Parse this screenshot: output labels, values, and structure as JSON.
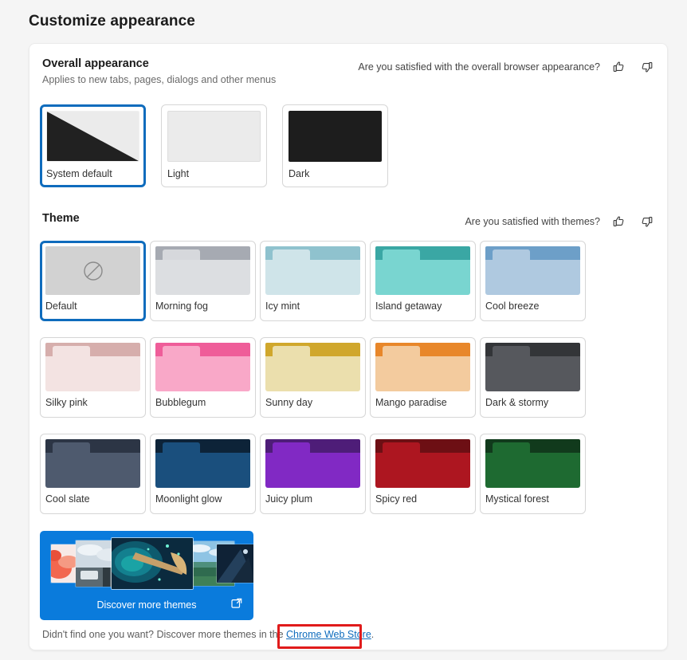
{
  "page": {
    "title": "Customize appearance",
    "background": "#f5f5f5",
    "accent": "#0f6cbd",
    "annotation_color": "#e01b1b"
  },
  "overall_appearance": {
    "title": "Overall appearance",
    "subtitle": "Applies to new tabs, pages, dialogs and other menus",
    "feedback": {
      "question": "Are you satisfied with the overall browser appearance?",
      "thumbs_up": "thumbs-up-icon",
      "thumbs_down": "thumbs-down-icon"
    },
    "options": [
      {
        "label": "System default",
        "selected": true,
        "kind": "split",
        "light": "#ebebeb",
        "dark": "#212121"
      },
      {
        "label": "Light",
        "selected": false,
        "kind": "solid",
        "fill": "#ebebeb"
      },
      {
        "label": "Dark",
        "selected": false,
        "kind": "solid",
        "fill": "#1d1d1d"
      }
    ]
  },
  "theme": {
    "title": "Theme",
    "feedback": {
      "question": "Are you satisfied with themes?",
      "thumbs_up": "thumbs-up-icon",
      "thumbs_down": "thumbs-down-icon"
    },
    "items": [
      {
        "label": "Default",
        "selected": true,
        "none": true,
        "icon": "no-theme-icon"
      },
      {
        "label": "Morning fog",
        "selected": false,
        "frame": "#a6aab2",
        "tab": "#d6d8dc",
        "body": "#dcdee1"
      },
      {
        "label": "Icy mint",
        "selected": false,
        "frame": "#8fc2ce",
        "tab": "#cfe4e9",
        "body": "#cfe4e9"
      },
      {
        "label": "Island getaway",
        "selected": false,
        "frame": "#3aa7a4",
        "tab": "#79d5d0",
        "body": "#79d5d0"
      },
      {
        "label": "Cool breeze",
        "selected": false,
        "frame": "#6d9fc8",
        "tab": "#afc9e0",
        "body": "#afc9e0"
      },
      {
        "label": "Silky pink",
        "selected": false,
        "frame": "#d6aeac",
        "tab": "#f3e3e2",
        "body": "#f3e3e2"
      },
      {
        "label": "Bubblegum",
        "selected": false,
        "frame": "#ef5d99",
        "tab": "#f9a8c8",
        "body": "#f9a8c8"
      },
      {
        "label": "Sunny day",
        "selected": false,
        "frame": "#d0a72c",
        "tab": "#ebdfad",
        "body": "#ebdfad"
      },
      {
        "label": "Mango paradise",
        "selected": false,
        "frame": "#e8872a",
        "tab": "#f3cb9e",
        "body": "#f3cb9e"
      },
      {
        "label": "Dark & stormy",
        "selected": false,
        "frame": "#333538",
        "tab": "#56585d",
        "body": "#56585d"
      },
      {
        "label": "Cool slate",
        "selected": false,
        "frame": "#2c3545",
        "tab": "#4e5a6e",
        "body": "#4e5a6e"
      },
      {
        "label": "Moonlight glow",
        "selected": false,
        "frame": "#0d2338",
        "tab": "#1a4f7d",
        "body": "#1a4f7d"
      },
      {
        "label": "Juicy plum",
        "selected": false,
        "frame": "#4e1d78",
        "tab": "#8129c4",
        "body": "#8129c4"
      },
      {
        "label": "Spicy red",
        "selected": false,
        "frame": "#6d0f14",
        "tab": "#ad1620",
        "body": "#ad1620"
      },
      {
        "label": "Mystical forest",
        "selected": false,
        "frame": "#113a1c",
        "tab": "#1e6a31",
        "body": "#1e6a31"
      }
    ]
  },
  "discover": {
    "label": "Discover more themes",
    "external_icon": "external-link-icon",
    "background": "#0a7bdc"
  },
  "footer": {
    "text_before": "Didn't find one you want? Discover more themes in the ",
    "link_text": "Chrome Web Store",
    "text_after": "."
  }
}
